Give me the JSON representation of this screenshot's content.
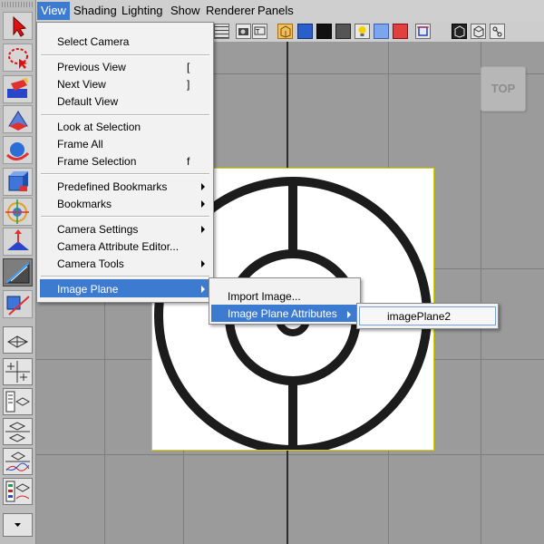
{
  "menubar": {
    "items": [
      "View",
      "Shading",
      "Lighting",
      "Show",
      "Renderer",
      "Panels"
    ]
  },
  "view_menu": {
    "items": [
      {
        "label": "Select Camera"
      },
      {
        "label": "Previous View",
        "shortcut": "["
      },
      {
        "label": "Next View",
        "shortcut": "]"
      },
      {
        "label": "Default View"
      },
      {
        "label": "Look at Selection"
      },
      {
        "label": "Frame All"
      },
      {
        "label": "Frame Selection",
        "shortcut": "f"
      },
      {
        "label": "Predefined Bookmarks",
        "submenu": true
      },
      {
        "label": "Bookmarks",
        "submenu": true
      },
      {
        "label": "Camera Settings",
        "submenu": true
      },
      {
        "label": "Camera Attribute Editor..."
      },
      {
        "label": "Camera Tools",
        "submenu": true
      },
      {
        "label": "Image Plane",
        "submenu": true,
        "highlighted": true
      }
    ]
  },
  "image_plane_submenu": {
    "items": [
      {
        "label": "Import Image..."
      },
      {
        "label": "Image Plane Attributes",
        "submenu": true,
        "highlighted": true
      }
    ]
  },
  "image_plane_attributes_submenu": {
    "items": [
      {
        "label": "imagePlane2"
      }
    ]
  },
  "viewcube": {
    "label": "TOP"
  },
  "colors": {
    "menu_highlight": "#3d7bd1",
    "viewport_background": "#9b9b9b",
    "image_plane_border": "#d8d000"
  },
  "icons": {
    "toolbox": [
      "select-arrow-icon",
      "lasso-icon",
      "paint-select-icon",
      "move-icon",
      "rotate-icon",
      "scale-icon",
      "universal-manipulator-icon",
      "soft-modification-icon",
      "show-manipulator-icon",
      "last-tool-icon"
    ],
    "layouts": [
      "single-perspective-layout-icon",
      "four-view-layout-icon",
      "outliner-layout-icon",
      "two-view-layout-icon",
      "graph-editor-layout-icon",
      "hypershade-layout-icon",
      "script-editor-layout-icon"
    ]
  }
}
